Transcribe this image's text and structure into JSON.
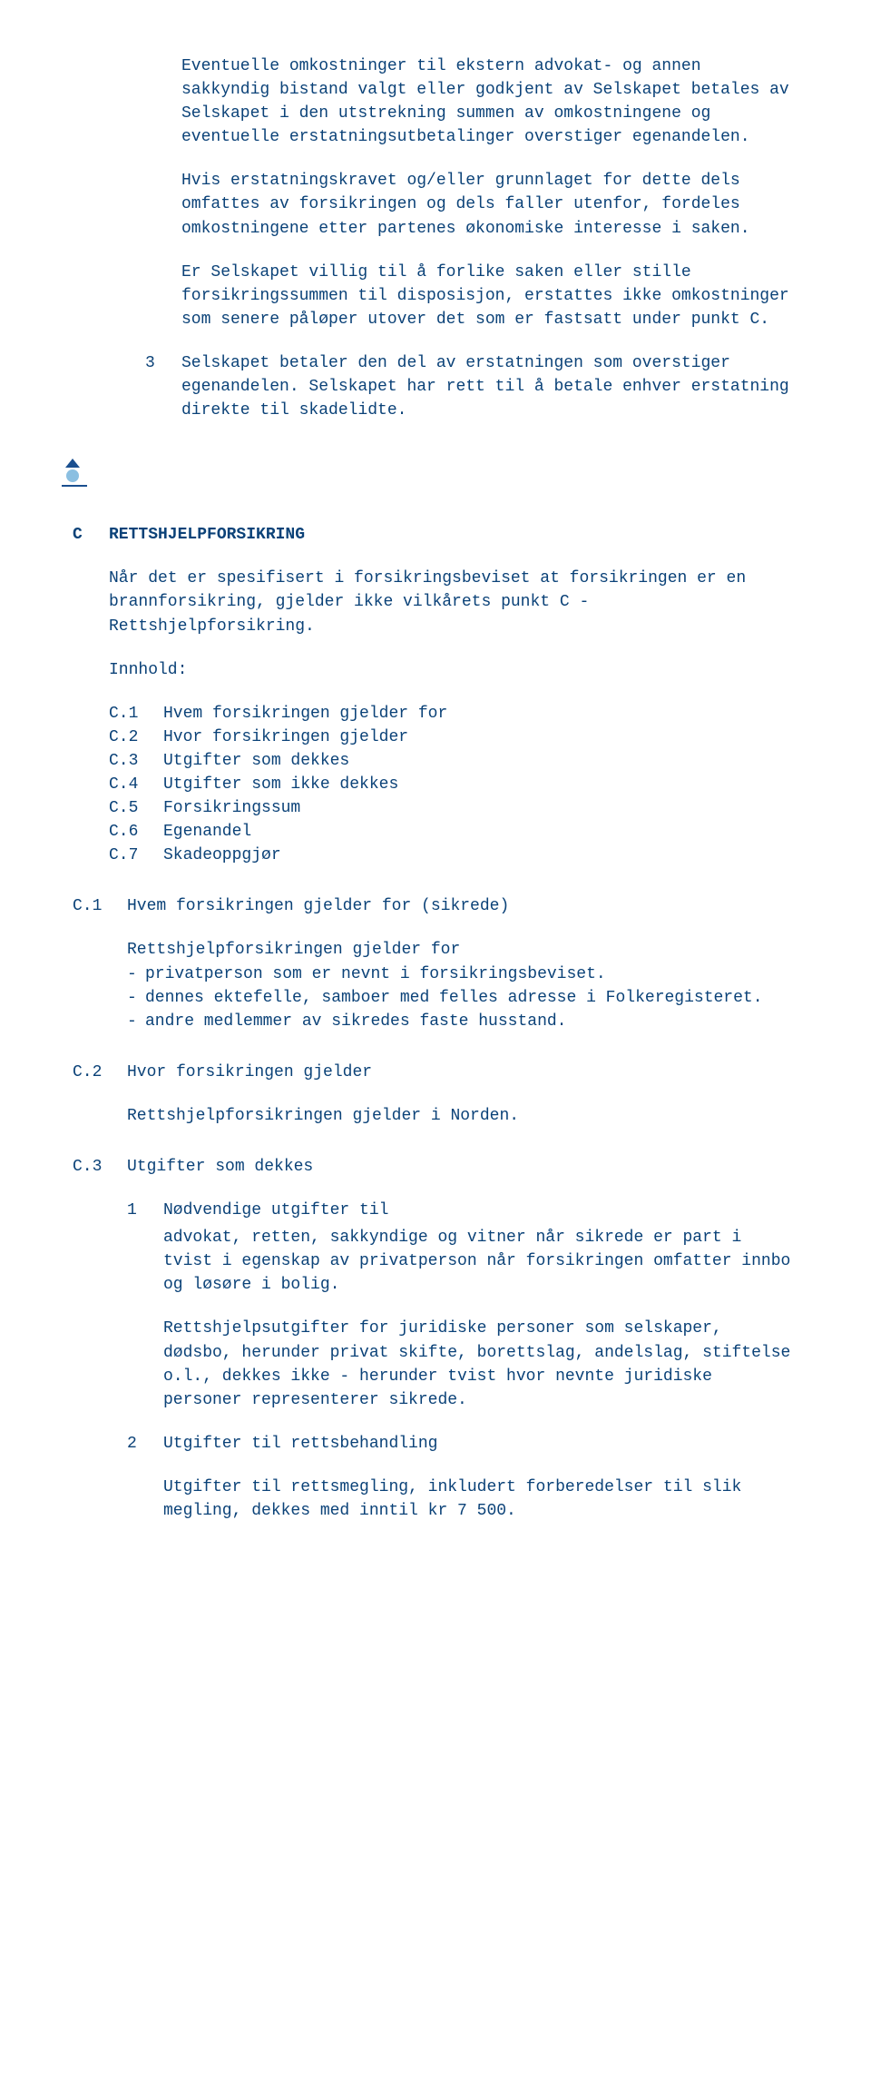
{
  "section_pre": {
    "p1": "Eventuelle omkostninger til ekstern advokat- og annen sakkyndig bistand valgt eller godkjent av Selskapet betales av Selskapet i den utstrekning summen av omkostningene og eventuelle erstatningsutbetalinger overstiger egenandelen.",
    "p2": "Hvis erstatningskravet og/eller grunnlaget for dette dels omfattes av forsikringen og dels faller utenfor, fordeles omkostningene etter partenes økonomiske interesse i saken.",
    "p3": "Er Selskapet villig til å forlike saken eller stille forsikringssummen til disposisjon, erstattes ikke omkostninger som senere påløper utover det som er fastsatt under punkt C.",
    "item3_num": "3",
    "item3_txt": "Selskapet betaler den del av erstatningen som overstiger egenandelen. Selskapet har rett til å betale enhver erstatning direkte til skadelidte."
  },
  "sectionC": {
    "label": "C",
    "title": "RETTSHJELPFORSIKRING",
    "intro": "Når det er spesifisert i forsikringsbeviset at forsikringen er en brannforsikring, gjelder ikke vilkårets punkt C - Rettshjelpforsikring.",
    "innhold_label": "Innhold:",
    "toc": [
      {
        "k": "C.1",
        "v": "Hvem forsikringen gjelder for"
      },
      {
        "k": "C.2",
        "v": "Hvor forsikringen gjelder"
      },
      {
        "k": "C.3",
        "v": "Utgifter som dekkes"
      },
      {
        "k": "C.4",
        "v": "Utgifter som ikke dekkes"
      },
      {
        "k": "C.5",
        "v": "Forsikringssum"
      },
      {
        "k": "C.6",
        "v": "Egenandel"
      },
      {
        "k": "C.7",
        "v": "Skadeoppgjør"
      }
    ]
  },
  "c1": {
    "label": "C.1",
    "title": "Hvem forsikringen gjelder for (sikrede)",
    "lead": "Rettshjelpforsikringen gjelder for",
    "items": [
      "privatperson som er nevnt i forsikringsbeviset.",
      "dennes ektefelle, samboer med felles adresse i Folkeregisteret.",
      "andre medlemmer av sikredes faste husstand."
    ]
  },
  "c2": {
    "label": "C.2",
    "title": "Hvor forsikringen gjelder",
    "text": "Rettshjelpforsikringen gjelder i Norden."
  },
  "c3": {
    "label": "C.3",
    "title": "Utgifter som dekkes",
    "item1_num": "1",
    "item1_lead": "Nødvendige utgifter til",
    "item1_body": "advokat, retten, sakkyndige og vitner når sikrede er part i tvist i egenskap av privatperson når forsikringen omfatter innbo og løsøre i bolig.",
    "item1_p2": "Rettshjelpsutgifter for juridiske personer som selskaper, dødsbo, herunder privat skifte, borettslag, andelslag, stiftelse o.l., dekkes ikke - herunder tvist hvor nevnte juridiske personer representerer sikrede.",
    "item2_num": "2",
    "item2_title": "Utgifter til rettsbehandling",
    "item2_body": "Utgifter til rettsmegling, inkludert forberedelser til slik megling, dekkes med inntil kr 7 500."
  }
}
